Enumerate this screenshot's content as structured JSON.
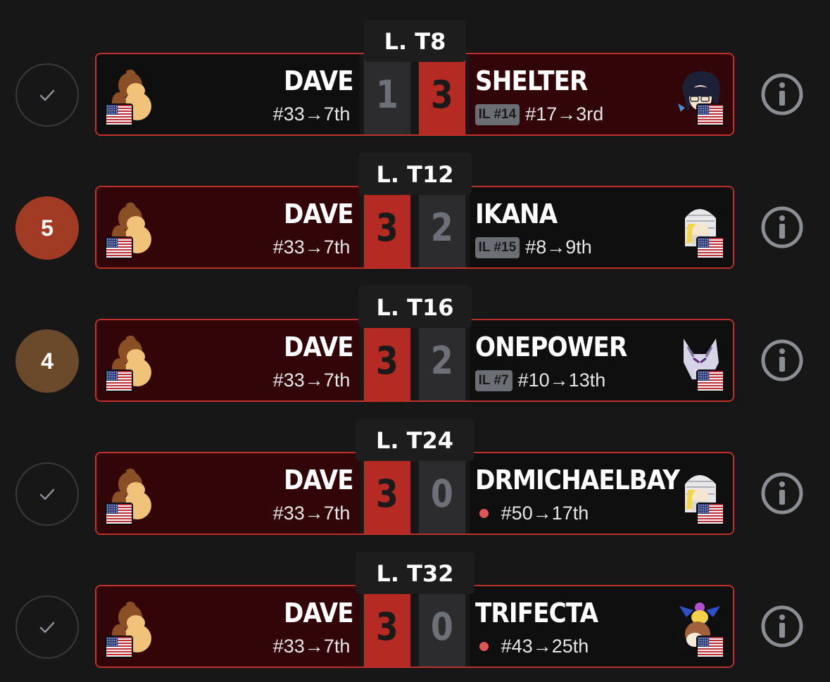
{
  "colors": {
    "background": "#171717",
    "win_fill": "#b52a22",
    "win_panel": "#320608",
    "lose_fill": "#2c2c2e",
    "border_red": "#c0302a"
  },
  "matches": [
    {
      "round": "L. T8",
      "status": "check",
      "status_icon": "check-icon",
      "left": {
        "name": "DAVE",
        "seed": "#33→7th",
        "flag": "us-flag-icon",
        "character": "donkey-kong-icon"
      },
      "right": {
        "name": "SHELTER",
        "il": "IL #14",
        "seed": "#17→3rd",
        "flag": "us-flag-icon",
        "character": "bayonetta-icon"
      },
      "left_score": "1",
      "right_score": "3",
      "winner": "right"
    },
    {
      "round": "L. T12",
      "status": "badge",
      "badge": "5",
      "badge_color": "#a23b23",
      "left": {
        "name": "DAVE",
        "seed": "#33→7th",
        "flag": "us-flag-icon",
        "character": "donkey-kong-icon"
      },
      "right": {
        "name": "IKANA",
        "il": "IL #15",
        "seed": "#8→9th",
        "flag": "us-flag-icon",
        "character": "sheik-icon"
      },
      "left_score": "3",
      "right_score": "2",
      "winner": "left"
    },
    {
      "round": "L. T16",
      "status": "badge",
      "badge": "4",
      "badge_color": "#6b4a2b",
      "left": {
        "name": "DAVE",
        "seed": "#33→7th",
        "flag": "us-flag-icon",
        "character": "donkey-kong-icon"
      },
      "right": {
        "name": "ONEPOWER",
        "il": "IL #7",
        "seed": "#10→13th",
        "flag": "us-flag-icon",
        "character": "wolf-icon"
      },
      "left_score": "3",
      "right_score": "2",
      "winner": "left"
    },
    {
      "round": "L. T24",
      "status": "check",
      "status_icon": "check-icon",
      "left": {
        "name": "DAVE",
        "seed": "#33→7th",
        "flag": "us-flag-icon",
        "character": "donkey-kong-icon"
      },
      "right": {
        "name": "DRMICHAELBAY",
        "dot": true,
        "seed": "#50→17th",
        "flag": "us-flag-icon",
        "character": "sheik-icon"
      },
      "left_score": "3",
      "right_score": "0",
      "winner": "left"
    },
    {
      "round": "L. T32",
      "status": "check",
      "status_icon": "check-icon",
      "left": {
        "name": "DAVE",
        "seed": "#33→7th",
        "flag": "us-flag-icon",
        "character": "donkey-kong-icon"
      },
      "right": {
        "name": "TRIFECTA",
        "dot": true,
        "seed": "#43→25th",
        "flag": "us-flag-icon",
        "character": "duck-hunt-icon"
      },
      "left_score": "3",
      "right_score": "0",
      "winner": "left"
    }
  ],
  "info_icon": "info-icon"
}
